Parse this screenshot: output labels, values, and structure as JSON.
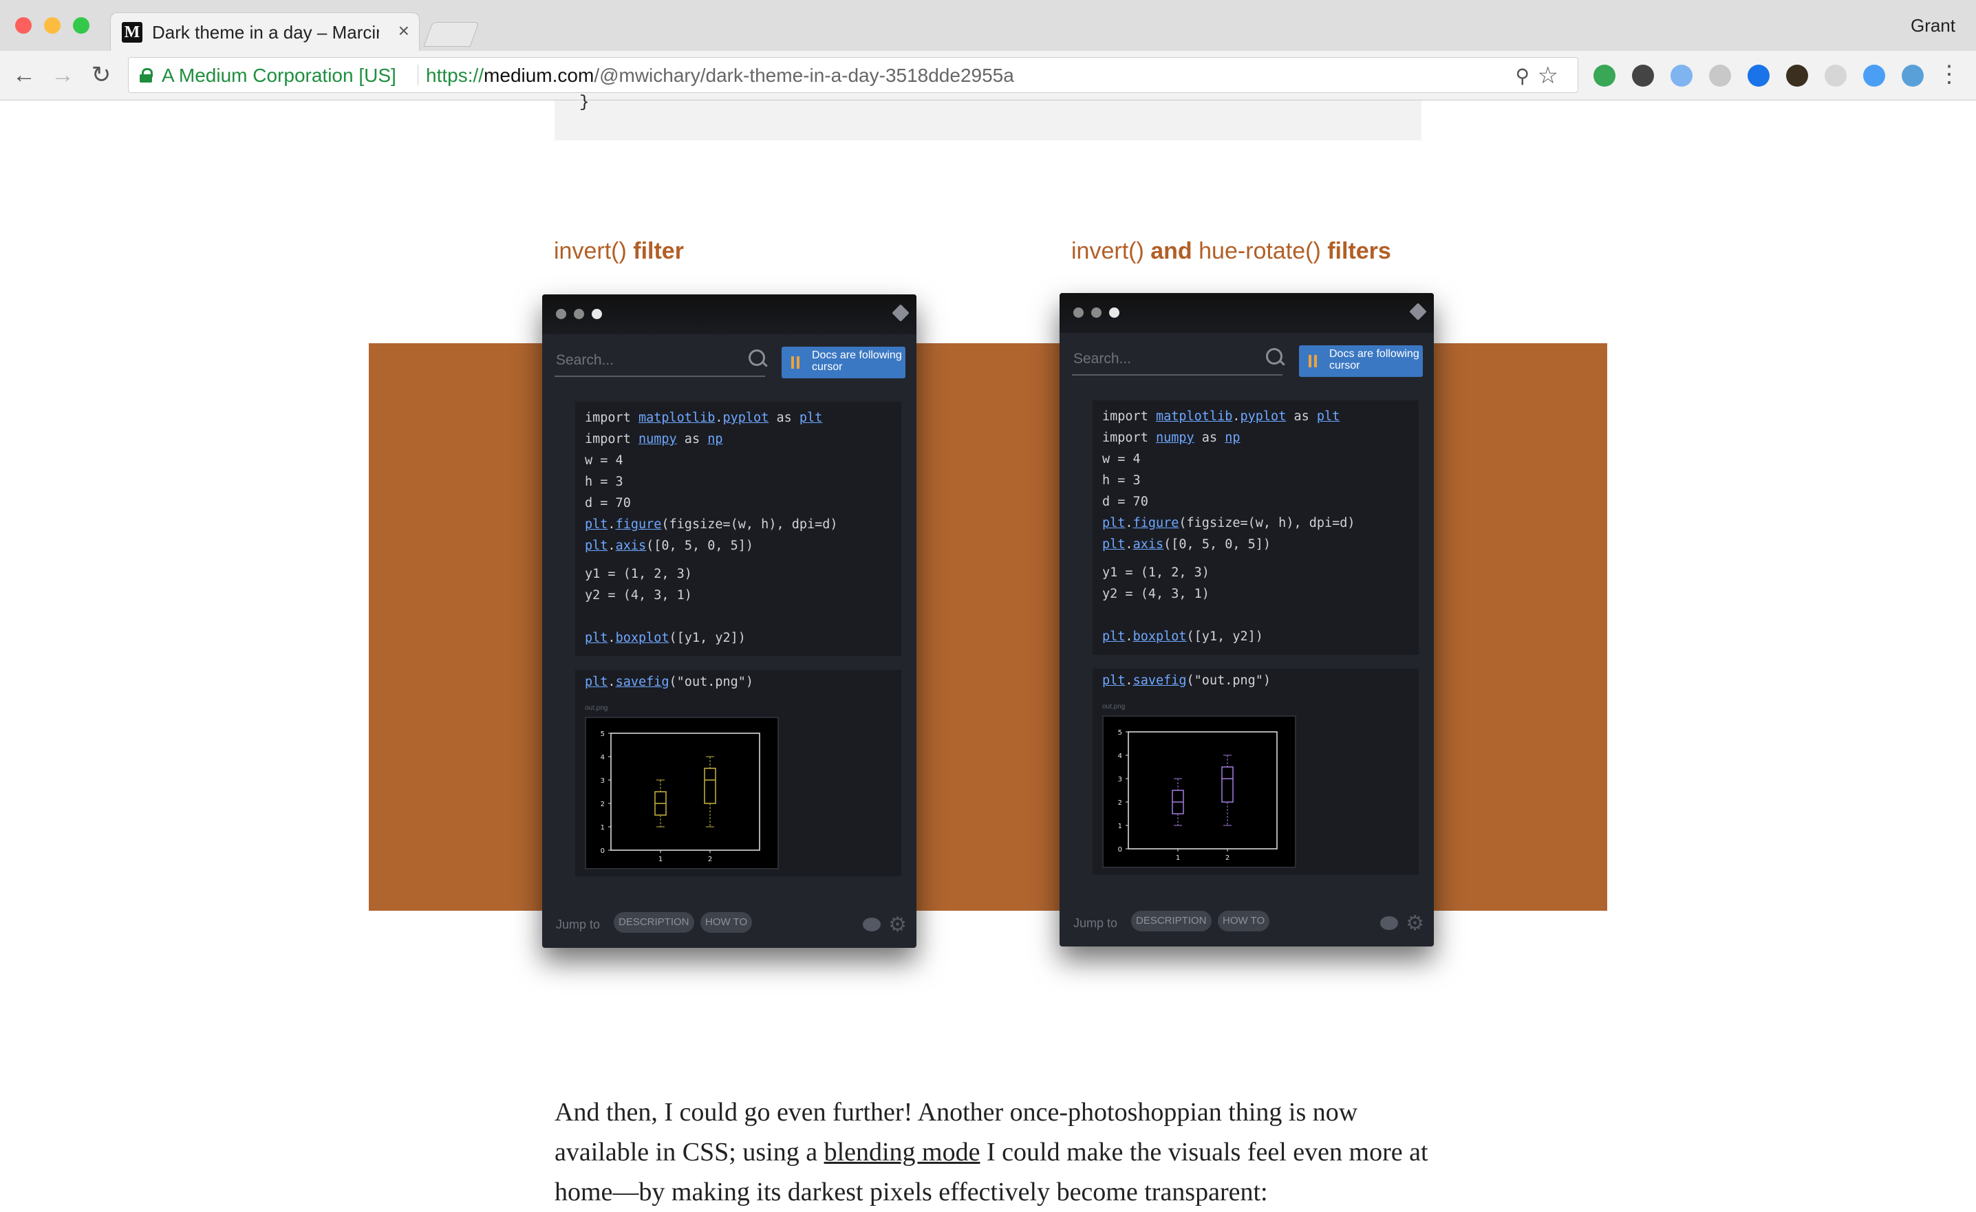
{
  "browser": {
    "tab_title": "Dark theme in a day – Marcin W",
    "tab_favicon": "M",
    "tab_close": "×",
    "profile_name": "Grant",
    "org": "A Medium Corporation [US]",
    "url_scheme": "https://",
    "url_host": "medium.com",
    "url_path": "/@mwichary/dark-theme-in-a-day-3518dde2955a",
    "nav_icons": [
      "back-arrow-icon",
      "forward-arrow-icon",
      "reload-icon"
    ],
    "glyphs": {
      "back": "←",
      "forward": "→",
      "reload": "↻",
      "zoom": "⚲",
      "star": "☆",
      "menu": "⋮"
    },
    "extensions": [
      {
        "name": "ext-green-icon",
        "color": "#3aa757"
      },
      {
        "name": "ext-dark-icon",
        "color": "#444444"
      },
      {
        "name": "ext-blue-leaf-icon",
        "color": "#7fb4f0"
      },
      {
        "name": "ext-r-icon",
        "color": "#c8c8c8"
      },
      {
        "name": "ext-blue-ring-icon",
        "color": "#1a73e8"
      },
      {
        "name": "ext-k-icon",
        "color": "#3b3020"
      },
      {
        "name": "ext-shield-icon",
        "color": "#d6d6d6"
      },
      {
        "name": "ext-circle-blue-icon",
        "color": "#4a9ff5"
      },
      {
        "name": "ext-circle-light-icon",
        "color": "#5aa0d8"
      }
    ]
  },
  "article": {
    "code_tail": "}",
    "captions": [
      {
        "parts": [
          "invert()",
          " filter"
        ]
      },
      {
        "parts": [
          "invert()",
          " and ",
          "hue-rotate()",
          " filters"
        ]
      }
    ],
    "colors": {
      "caption": "#b25f26",
      "banner": "#b0652f"
    },
    "screens": [
      {
        "search_placeholder": "Search...",
        "docs_button": "Docs are following cursor",
        "code_lines": [
          "import matplotlib.pyplot as plt",
          "import numpy as np",
          "w = 4",
          "h = 3",
          "d = 70",
          "plt.figure(figsize=(w, h), dpi=d)",
          "plt.axis([0, 5, 0, 5])",
          "y1 = (1, 2, 3)",
          "y2 = (4, 3, 1)",
          "",
          "plt.boxplot([y1, y2])"
        ],
        "save_line": "plt.savefig(\"out.png\")",
        "output_label": "out.png",
        "jump_label": "Jump to",
        "pills": [
          "DESCRIPTION",
          "HOW TO"
        ],
        "plot_color": "#c9b641"
      },
      {
        "search_placeholder": "Search...",
        "docs_button": "Docs are following cursor",
        "code_lines": [
          "import matplotlib.pyplot as plt",
          "import numpy as np",
          "w = 4",
          "h = 3",
          "d = 70",
          "plt.figure(figsize=(w, h), dpi=d)",
          "plt.axis([0, 5, 0, 5])",
          "y1 = (1, 2, 3)",
          "y2 = (4, 3, 1)",
          "",
          "plt.boxplot([y1, y2])"
        ],
        "save_line": "plt.savefig(\"out.png\")",
        "output_label": "out.png",
        "jump_label": "Jump to",
        "pills": [
          "DESCRIPTION",
          "HOW TO"
        ],
        "plot_color": "#a47ee0"
      }
    ],
    "plot": {
      "x_ticks": [
        "1",
        "2"
      ],
      "y_ticks": [
        "0",
        "1",
        "2",
        "3",
        "4",
        "5"
      ],
      "ylim": [
        0,
        5
      ],
      "xlim": [
        0,
        3
      ],
      "boxes": [
        {
          "x": 1,
          "min": 1,
          "q1": 1.5,
          "median": 2,
          "q3": 2.5,
          "max": 3
        },
        {
          "x": 2,
          "min": 1,
          "q1": 2,
          "median": 3,
          "q3": 3.5,
          "max": 4
        }
      ]
    },
    "paragraph": {
      "before": "And then, I could go even further! Another once-photoshoppian thing is now available in CSS; using a ",
      "link": "blending mode",
      "after": " I could make the visuals feel even more at home—by making its darkest pixels effectively become transparent:"
    }
  }
}
